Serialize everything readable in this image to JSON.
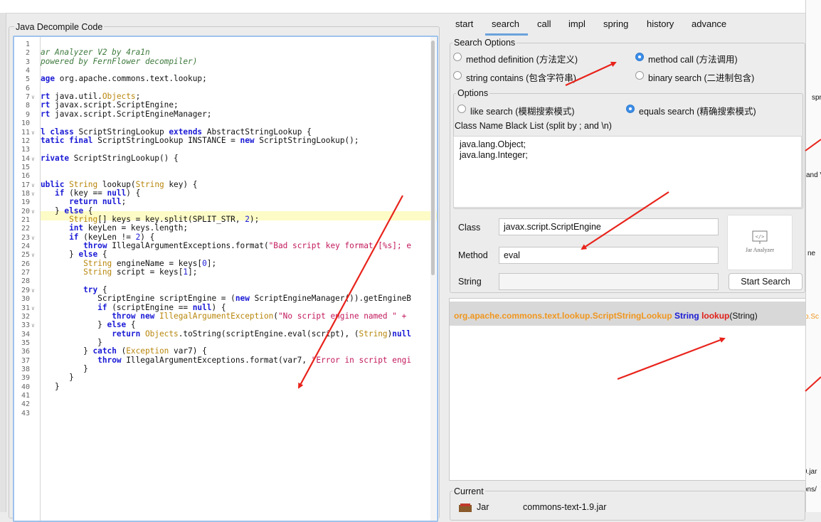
{
  "code_panel": {
    "title": "Java Decompile Code",
    "line_numbers": [
      "1",
      "2",
      "3",
      "4",
      "5",
      "6",
      "7",
      "8",
      "9",
      "10",
      "11",
      "12",
      "13",
      "14",
      "15",
      "16",
      "17",
      "18",
      "19",
      "20",
      "21",
      "22",
      "23",
      "24",
      "25",
      "26",
      "27",
      "28",
      "29",
      "30",
      "31",
      "32",
      "33",
      "34",
      "35",
      "36",
      "37",
      "38",
      "39",
      "40",
      "41",
      "42",
      "43"
    ],
    "lines": [
      [],
      [
        {
          "t": "ar Analyzer V2 by 4ra1n",
          "c": "cm"
        }
      ],
      [
        {
          "t": "powered by FernFlower decompiler)",
          "c": "cm"
        }
      ],
      [],
      [
        {
          "t": "age",
          "c": "kw"
        },
        {
          "t": " org.apache.commons.text.lookup;",
          "c": ""
        }
      ],
      [],
      [
        {
          "t": "rt",
          "c": "kw"
        },
        {
          "t": " java.util.",
          "c": ""
        },
        {
          "t": "Objects",
          "c": "ty"
        },
        {
          "t": ";",
          "c": ""
        }
      ],
      [
        {
          "t": "rt",
          "c": "kw"
        },
        {
          "t": " javax.script.ScriptEngine;",
          "c": ""
        }
      ],
      [
        {
          "t": "rt",
          "c": "kw"
        },
        {
          "t": " javax.script.ScriptEngineManager;",
          "c": ""
        }
      ],
      [],
      [
        {
          "t": "l class",
          "c": "kw"
        },
        {
          "t": " ScriptStringLookup ",
          "c": ""
        },
        {
          "t": "extends",
          "c": "kw"
        },
        {
          "t": " AbstractStringLookup {",
          "c": ""
        }
      ],
      [
        {
          "t": "tatic final",
          "c": "kw"
        },
        {
          "t": " ScriptStringLookup INSTANCE = ",
          "c": ""
        },
        {
          "t": "new",
          "c": "kw"
        },
        {
          "t": " ScriptStringLookup();",
          "c": ""
        }
      ],
      [],
      [
        {
          "t": "rivate",
          "c": "kw"
        },
        {
          "t": " ScriptStringLookup() {",
          "c": ""
        }
      ],
      [],
      [],
      [
        {
          "t": "ublic",
          "c": "kw"
        },
        {
          "t": " ",
          "c": ""
        },
        {
          "t": "String",
          "c": "ty"
        },
        {
          "t": " lookup(",
          "c": ""
        },
        {
          "t": "String",
          "c": "ty"
        },
        {
          "t": " key) {",
          "c": ""
        }
      ],
      [
        {
          "t": "   ",
          "c": ""
        },
        {
          "t": "if",
          "c": "kw"
        },
        {
          "t": " (key == ",
          "c": ""
        },
        {
          "t": "null",
          "c": "kw"
        },
        {
          "t": ") {",
          "c": ""
        }
      ],
      [
        {
          "t": "      ",
          "c": ""
        },
        {
          "t": "return null",
          "c": "kw"
        },
        {
          "t": ";",
          "c": ""
        }
      ],
      [
        {
          "t": "   } ",
          "c": ""
        },
        {
          "t": "else",
          "c": "kw"
        },
        {
          "t": " {",
          "c": ""
        }
      ],
      [
        {
          "t": "      ",
          "c": ""
        },
        {
          "t": "String",
          "c": "ty"
        },
        {
          "t": "[] keys = key.split(SPLIT_STR, ",
          "c": ""
        },
        {
          "t": "2",
          "c": "nu"
        },
        {
          "t": ");",
          "c": ""
        }
      ],
      [
        {
          "t": "      ",
          "c": ""
        },
        {
          "t": "int",
          "c": "kw"
        },
        {
          "t": " keyLen = keys.length;",
          "c": ""
        }
      ],
      [
        {
          "t": "      ",
          "c": ""
        },
        {
          "t": "if",
          "c": "kw"
        },
        {
          "t": " (keyLen != ",
          "c": ""
        },
        {
          "t": "2",
          "c": "nu"
        },
        {
          "t": ") {",
          "c": ""
        }
      ],
      [
        {
          "t": "         ",
          "c": ""
        },
        {
          "t": "throw",
          "c": "kw"
        },
        {
          "t": " IllegalArgumentExceptions.format(",
          "c": ""
        },
        {
          "t": "\"Bad script key format [%s]; e",
          "c": "st"
        }
      ],
      [
        {
          "t": "      } ",
          "c": ""
        },
        {
          "t": "else",
          "c": "kw"
        },
        {
          "t": " {",
          "c": ""
        }
      ],
      [
        {
          "t": "         ",
          "c": ""
        },
        {
          "t": "String",
          "c": "ty"
        },
        {
          "t": " engineName = keys[",
          "c": ""
        },
        {
          "t": "0",
          "c": "nu"
        },
        {
          "t": "];",
          "c": ""
        }
      ],
      [
        {
          "t": "         ",
          "c": ""
        },
        {
          "t": "String",
          "c": "ty"
        },
        {
          "t": " script = keys[",
          "c": ""
        },
        {
          "t": "1",
          "c": "nu"
        },
        {
          "t": "];",
          "c": ""
        }
      ],
      [],
      [
        {
          "t": "         ",
          "c": ""
        },
        {
          "t": "try",
          "c": "kw"
        },
        {
          "t": " {",
          "c": ""
        }
      ],
      [
        {
          "t": "            ScriptEngine scriptEngine = (",
          "c": ""
        },
        {
          "t": "new",
          "c": "kw"
        },
        {
          "t": " ScriptEngineManager()).getEngineB",
          "c": ""
        }
      ],
      [
        {
          "t": "            ",
          "c": ""
        },
        {
          "t": "if",
          "c": "kw"
        },
        {
          "t": " (scriptEngine == ",
          "c": ""
        },
        {
          "t": "null",
          "c": "kw"
        },
        {
          "t": ") {",
          "c": ""
        }
      ],
      [
        {
          "t": "               ",
          "c": ""
        },
        {
          "t": "throw new",
          "c": "kw"
        },
        {
          "t": " ",
          "c": ""
        },
        {
          "t": "IllegalArgumentException",
          "c": "ty"
        },
        {
          "t": "(",
          "c": ""
        },
        {
          "t": "\"No script engine named \" + ",
          "c": "st"
        }
      ],
      [
        {
          "t": "            } ",
          "c": ""
        },
        {
          "t": "else",
          "c": "kw"
        },
        {
          "t": " {",
          "c": ""
        }
      ],
      [
        {
          "t": "               ",
          "c": ""
        },
        {
          "t": "return",
          "c": "kw"
        },
        {
          "t": " ",
          "c": ""
        },
        {
          "t": "Objects",
          "c": "ty"
        },
        {
          "t": ".toString(scriptEngine.eval(script), (",
          "c": ""
        },
        {
          "t": "String",
          "c": "ty"
        },
        {
          "t": ")",
          "c": ""
        },
        {
          "t": "null",
          "c": "kw"
        }
      ],
      [
        {
          "t": "            }",
          "c": ""
        }
      ],
      [
        {
          "t": "         } ",
          "c": ""
        },
        {
          "t": "catch",
          "c": "kw"
        },
        {
          "t": " (",
          "c": ""
        },
        {
          "t": "Exception",
          "c": "ty"
        },
        {
          "t": " var7) {",
          "c": ""
        }
      ],
      [
        {
          "t": "            ",
          "c": ""
        },
        {
          "t": "throw",
          "c": "kw"
        },
        {
          "t": " IllegalArgumentExceptions.format(var7, ",
          "c": ""
        },
        {
          "t": "\"Error in script engi",
          "c": "st"
        }
      ],
      [
        {
          "t": "         }",
          "c": ""
        }
      ],
      [
        {
          "t": "      }",
          "c": ""
        }
      ],
      [
        {
          "t": "   }",
          "c": ""
        }
      ],
      [],
      [],
      []
    ],
    "fold_lines": [
      7,
      11,
      14,
      17,
      18,
      20,
      23,
      25,
      29,
      31,
      33
    ]
  },
  "tabs": [
    {
      "label": "start",
      "active": false
    },
    {
      "label": "search",
      "active": true
    },
    {
      "label": "call",
      "active": false
    },
    {
      "label": "impl",
      "active": false
    },
    {
      "label": "spring",
      "active": false
    },
    {
      "label": "history",
      "active": false
    },
    {
      "label": "advance",
      "active": false
    }
  ],
  "search_options": {
    "title": "Search Options",
    "method_definition": "method definition (方法定义)",
    "method_call": "method call (方法调用)",
    "string_contains": "string contains (包含字符串)",
    "binary_search": "binary search (二进制包含)",
    "selected": "method_call"
  },
  "options": {
    "title": "Options",
    "like_search": "like search (模糊搜索模式)",
    "equals_search": "equals search (精确搜索模式)",
    "selected": "equals_search",
    "blacklist_label": "Class Name Black List (split by ; and \\n)",
    "blacklist": [
      "java.lang.Object;",
      "java.lang.Integer;"
    ]
  },
  "fields": {
    "class_label": "Class",
    "class_value": "javax.script.ScriptEngine",
    "method_label": "Method",
    "method_value": "eval",
    "string_label": "String",
    "string_value": "",
    "start_button": "Start Search",
    "logo_text": "Jar Analyzer"
  },
  "result": {
    "class": "org.apache.commons.text.lookup.ScriptStringLookup",
    "return_type": "String",
    "method": "lookup",
    "params": "(String)"
  },
  "current": {
    "title": "Current",
    "jar_label": "Jar",
    "jar_value": "commons-text-1.9.jar"
  },
  "right_window": {
    "fragments": [
      "spr",
      "and V",
      "ne",
      "p.Sc",
      "9.jar",
      "ons/"
    ]
  },
  "colors": {
    "accent": "#3c8ee8",
    "result_class": "#f0961e",
    "result_type": "#1a1ad6",
    "result_method": "#e0201a",
    "annotation_arrow": "#e8231b"
  }
}
